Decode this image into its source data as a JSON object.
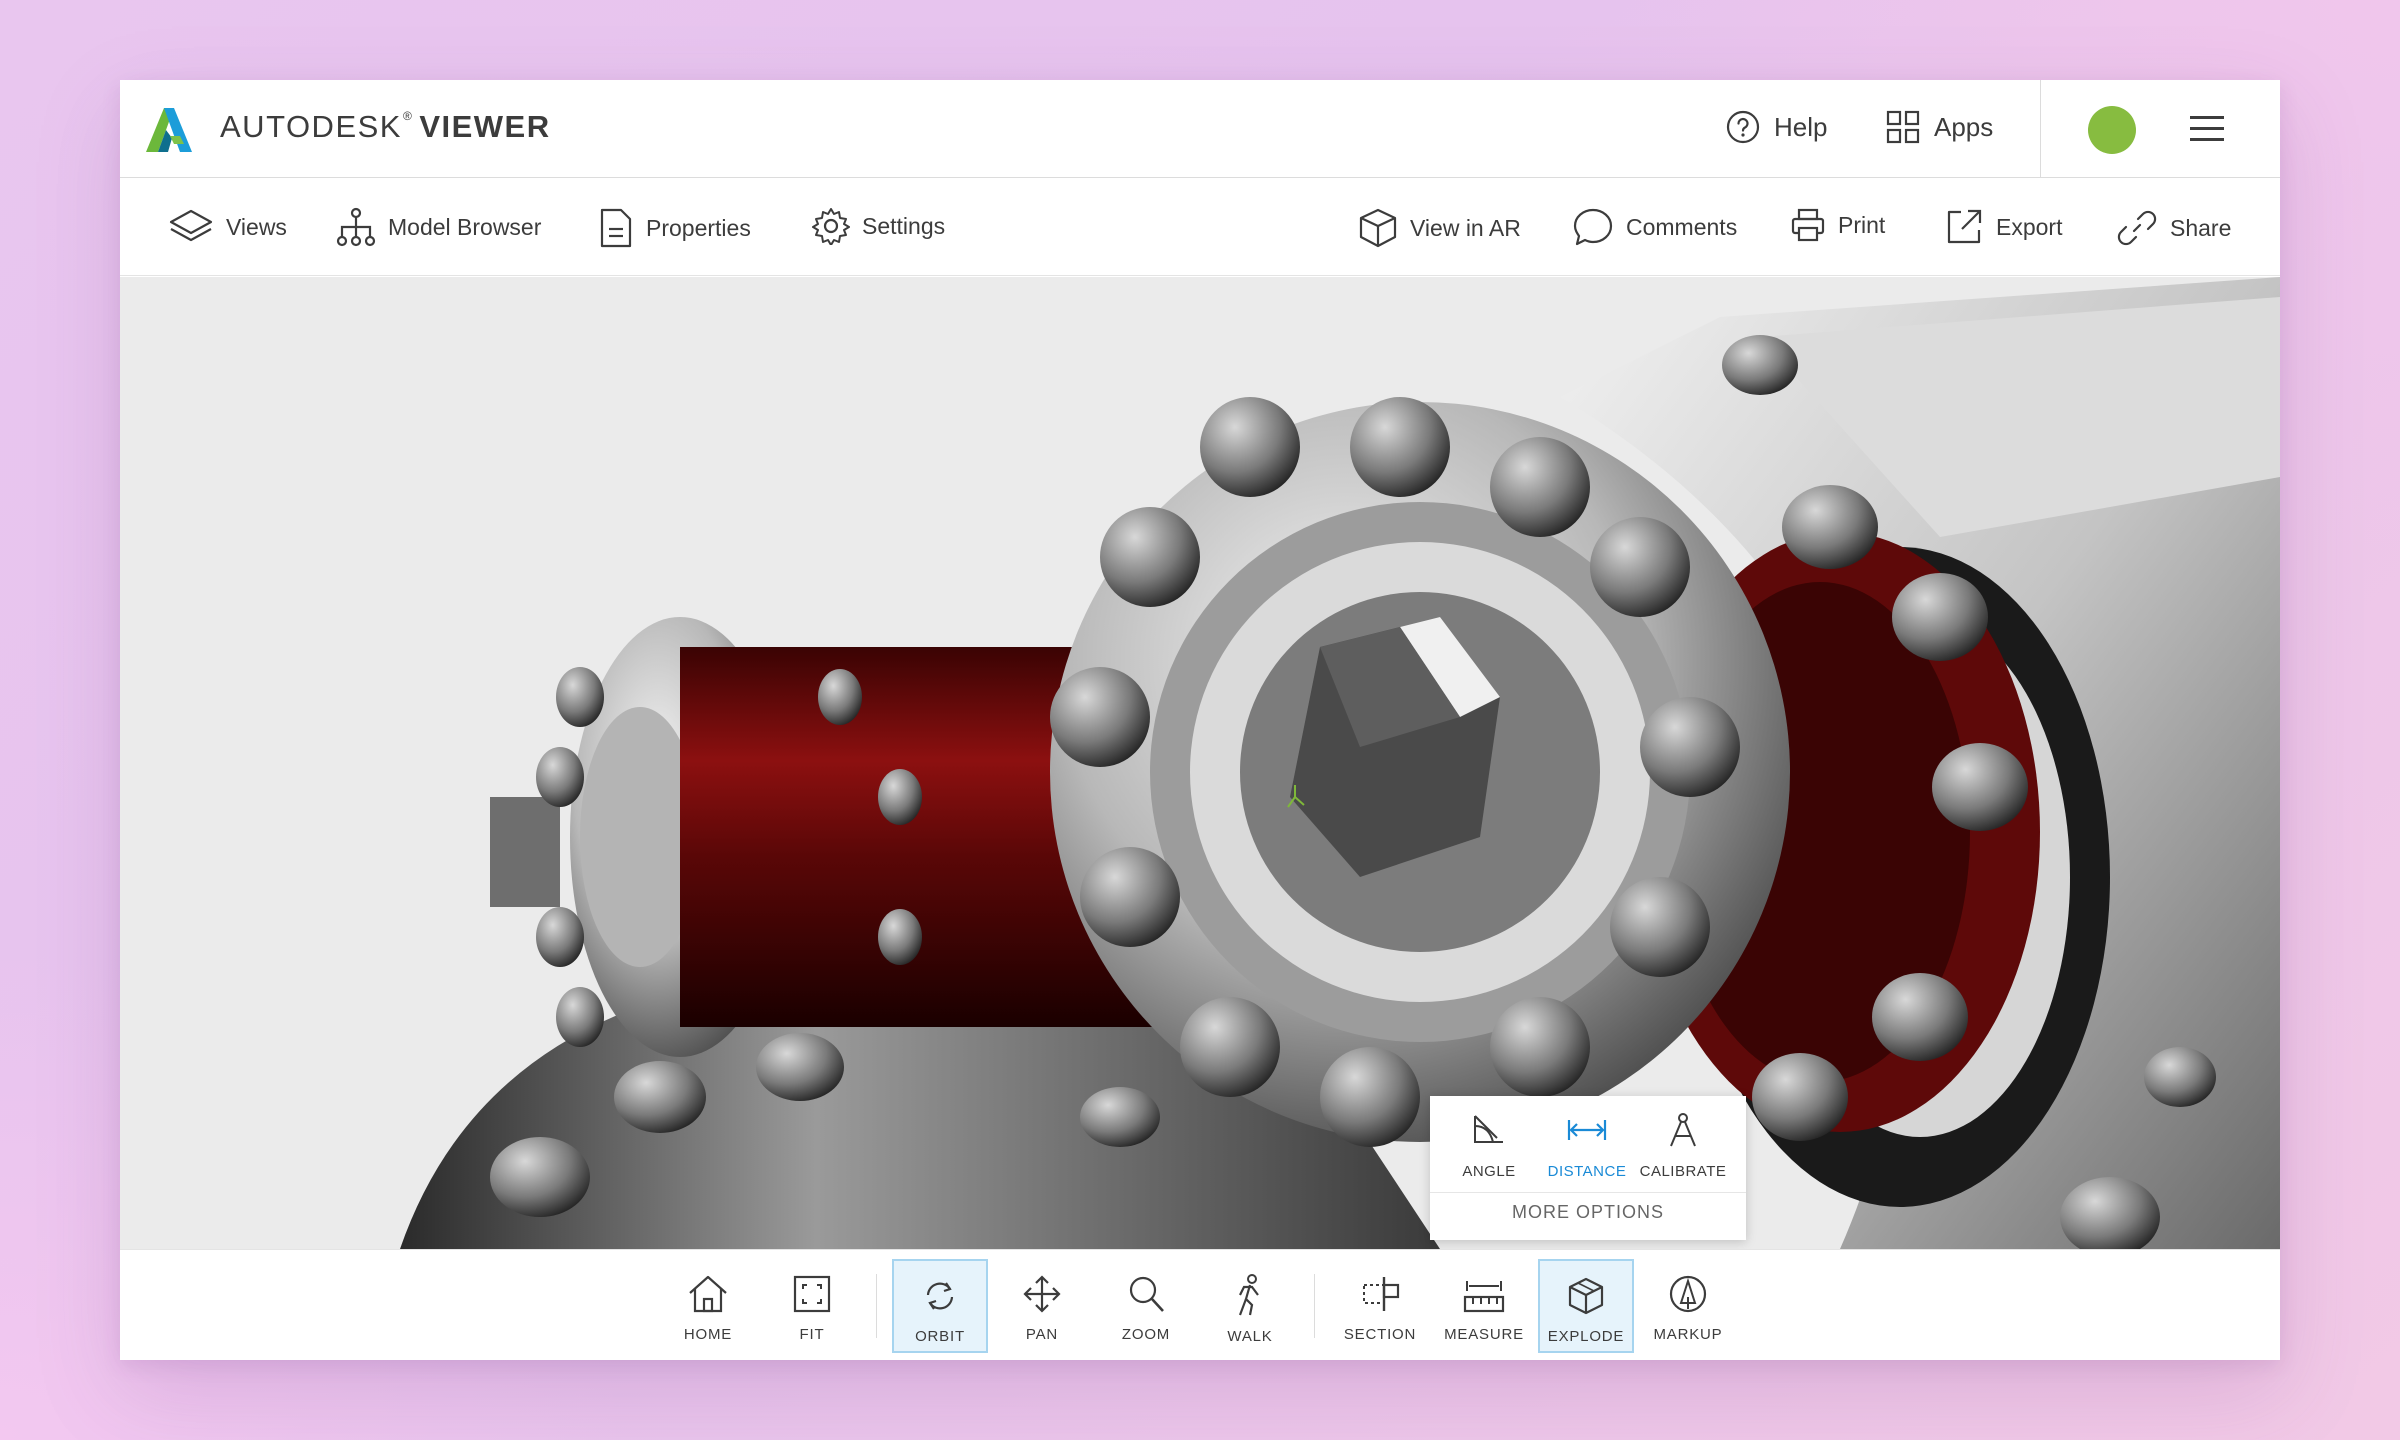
{
  "app": {
    "brand_prefix": "AUTODESK",
    "brand_mark": "®",
    "brand_product": "VIEWER"
  },
  "header": {
    "help_label": "Help",
    "apps_label": "Apps",
    "avatar_color": "#87bc40"
  },
  "toolbar": {
    "left": [
      {
        "label": "Views",
        "icon": "layers-icon"
      },
      {
        "label": "Model Browser",
        "icon": "hierarchy-icon"
      },
      {
        "label": "Properties",
        "icon": "document-icon"
      },
      {
        "label": "Settings",
        "icon": "gear-icon"
      }
    ],
    "right": [
      {
        "label": "View in AR",
        "icon": "cube-icon"
      },
      {
        "label": "Comments",
        "icon": "speech-bubble-icon"
      },
      {
        "label": "Print",
        "icon": "printer-icon"
      },
      {
        "label": "Export",
        "icon": "export-icon"
      },
      {
        "label": "Share",
        "icon": "link-icon"
      }
    ]
  },
  "measure_popover": {
    "tools": [
      {
        "label": "ANGLE",
        "icon": "angle-icon",
        "active": false
      },
      {
        "label": "DISTANCE",
        "icon": "distance-icon",
        "active": true
      },
      {
        "label": "CALIBRATE",
        "icon": "compass-icon",
        "active": false
      }
    ],
    "more_options": "MORE OPTIONS",
    "active_color": "#1a8ad6"
  },
  "bottom_toolbar": {
    "tools": [
      {
        "label": "HOME",
        "icon": "home-icon",
        "active": false
      },
      {
        "label": "FIT",
        "icon": "fit-icon",
        "active": false
      },
      {
        "label": "ORBIT",
        "icon": "orbit-icon",
        "active": true
      },
      {
        "label": "PAN",
        "icon": "pan-icon",
        "active": false
      },
      {
        "label": "ZOOM",
        "icon": "zoom-icon",
        "active": false
      },
      {
        "label": "WALK",
        "icon": "walk-icon",
        "active": false
      },
      {
        "label": "SECTION",
        "icon": "section-icon",
        "active": false
      },
      {
        "label": "MEASURE",
        "icon": "ruler-icon",
        "active": false
      },
      {
        "label": "EXPLODE",
        "icon": "explode-icon",
        "active": true
      },
      {
        "label": "MARKUP",
        "icon": "markup-icon",
        "active": false
      }
    ],
    "active_bg": "#e6f3fb",
    "active_border": "#a6d4ef"
  },
  "viewport": {
    "background": "#ebebeb",
    "model_accent": "#6e0c0c"
  }
}
